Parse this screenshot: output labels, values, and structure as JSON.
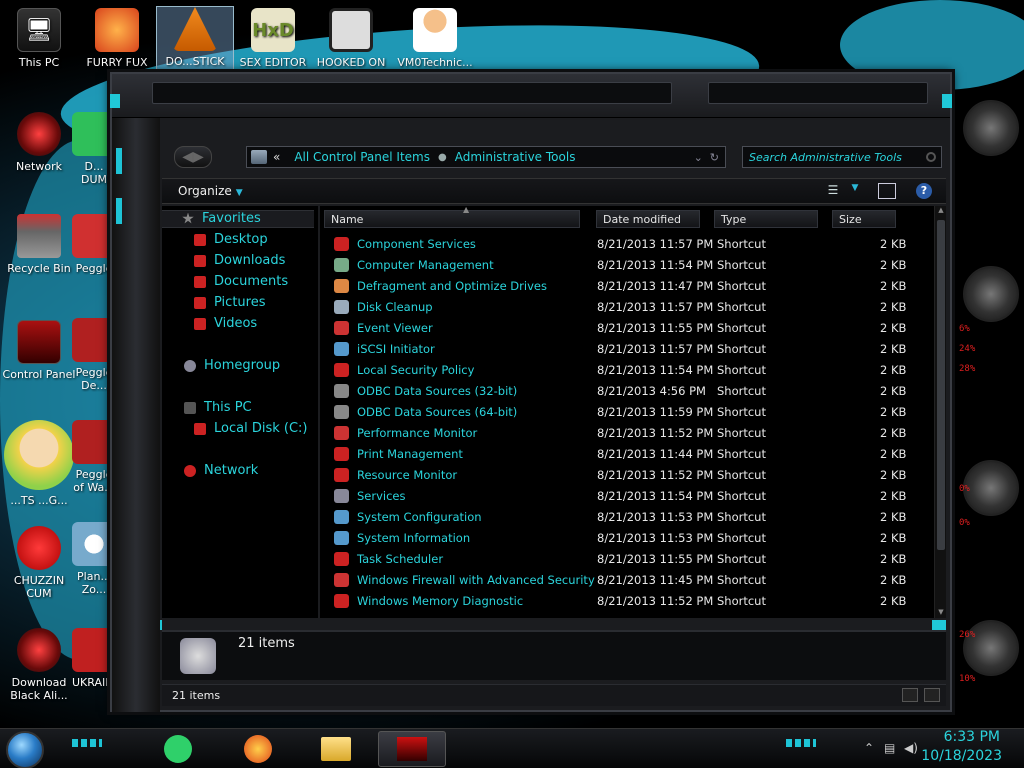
{
  "desktop": {
    "icons": [
      {
        "label": "This PC"
      },
      {
        "label": "FURRY FUX"
      },
      {
        "label": "DO...STICK"
      },
      {
        "label": "SEX EDITOR"
      },
      {
        "label": "HOOKED ON"
      },
      {
        "label": "VM0Technic..."
      },
      {
        "label": "Network"
      },
      {
        "label": "D... DUM"
      },
      {
        "label": "Recycle Bin"
      },
      {
        "label": "Peggle"
      },
      {
        "label": "Control Panel"
      },
      {
        "label": "Peggle De..."
      },
      {
        "label": "...TS ...G..."
      },
      {
        "label": "Peggle of Wa..."
      },
      {
        "label": "CHUZZIN CUM"
      },
      {
        "label": "Plan... Zo..."
      },
      {
        "label": "Download Black Ali..."
      },
      {
        "label": "UKRAINE"
      }
    ]
  },
  "gadget": {
    "values": [
      "6%",
      "24%",
      "28%",
      "0%",
      "0%",
      "26%",
      "10%"
    ]
  },
  "explorer": {
    "address": {
      "overflow": "«",
      "crumbs": [
        "All Control Panel Items",
        "Administrative Tools"
      ]
    },
    "search": {
      "placeholder": "Search Administrative Tools"
    },
    "toolbar": {
      "organize_label": "Organize"
    },
    "nav": {
      "favorites": "Favorites",
      "desktop": "Desktop",
      "downloads": "Downloads",
      "documents": "Documents",
      "pictures": "Pictures",
      "videos": "Videos",
      "homegroup": "Homegroup",
      "this_pc": "This PC",
      "local_disk": "Local Disk (C:)",
      "network": "Network"
    },
    "columns": {
      "name": "Name",
      "date": "Date modified",
      "type": "Type",
      "size": "Size"
    },
    "rows": [
      {
        "name": "Component Services",
        "date": "8/21/2013 11:57 PM",
        "type": "Shortcut",
        "size": "2 KB"
      },
      {
        "name": "Computer Management",
        "date": "8/21/2013 11:54 PM",
        "type": "Shortcut",
        "size": "2 KB"
      },
      {
        "name": "Defragment and Optimize Drives",
        "date": "8/21/2013 11:47 PM",
        "type": "Shortcut",
        "size": "2 KB"
      },
      {
        "name": "Disk Cleanup",
        "date": "8/21/2013 11:57 PM",
        "type": "Shortcut",
        "size": "2 KB"
      },
      {
        "name": "Event Viewer",
        "date": "8/21/2013 11:55 PM",
        "type": "Shortcut",
        "size": "2 KB"
      },
      {
        "name": "iSCSI Initiator",
        "date": "8/21/2013 11:57 PM",
        "type": "Shortcut",
        "size": "2 KB"
      },
      {
        "name": "Local Security Policy",
        "date": "8/21/2013 11:54 PM",
        "type": "Shortcut",
        "size": "2 KB"
      },
      {
        "name": "ODBC Data Sources (32-bit)",
        "date": "8/21/2013 4:56 PM",
        "type": "Shortcut",
        "size": "2 KB"
      },
      {
        "name": "ODBC Data Sources (64-bit)",
        "date": "8/21/2013 11:59 PM",
        "type": "Shortcut",
        "size": "2 KB"
      },
      {
        "name": "Performance Monitor",
        "date": "8/21/2013 11:52 PM",
        "type": "Shortcut",
        "size": "2 KB"
      },
      {
        "name": "Print Management",
        "date": "8/21/2013 11:44 PM",
        "type": "Shortcut",
        "size": "2 KB"
      },
      {
        "name": "Resource Monitor",
        "date": "8/21/2013 11:52 PM",
        "type": "Shortcut",
        "size": "2 KB"
      },
      {
        "name": "Services",
        "date": "8/21/2013 11:54 PM",
        "type": "Shortcut",
        "size": "2 KB"
      },
      {
        "name": "System Configuration",
        "date": "8/21/2013 11:53 PM",
        "type": "Shortcut",
        "size": "2 KB"
      },
      {
        "name": "System Information",
        "date": "8/21/2013 11:53 PM",
        "type": "Shortcut",
        "size": "2 KB"
      },
      {
        "name": "Task Scheduler",
        "date": "8/21/2013 11:55 PM",
        "type": "Shortcut",
        "size": "2 KB"
      },
      {
        "name": "Windows Firewall with Advanced Security",
        "date": "8/21/2013 11:45 PM",
        "type": "Shortcut",
        "size": "2 KB"
      },
      {
        "name": "Windows Memory Diagnostic",
        "date": "8/21/2013 11:52 PM",
        "type": "Shortcut",
        "size": "2 KB"
      }
    ],
    "details_count": "21 items",
    "status_text": "21 items"
  },
  "taskbar": {
    "time": "6:33 PM",
    "date": "10/18/2023"
  },
  "colors": {
    "accent_cyan": "#2bd4dc",
    "frame_accent": "#1ec4d6",
    "window_bg": "#1b1c1f",
    "gadget_red": "#e02020"
  }
}
